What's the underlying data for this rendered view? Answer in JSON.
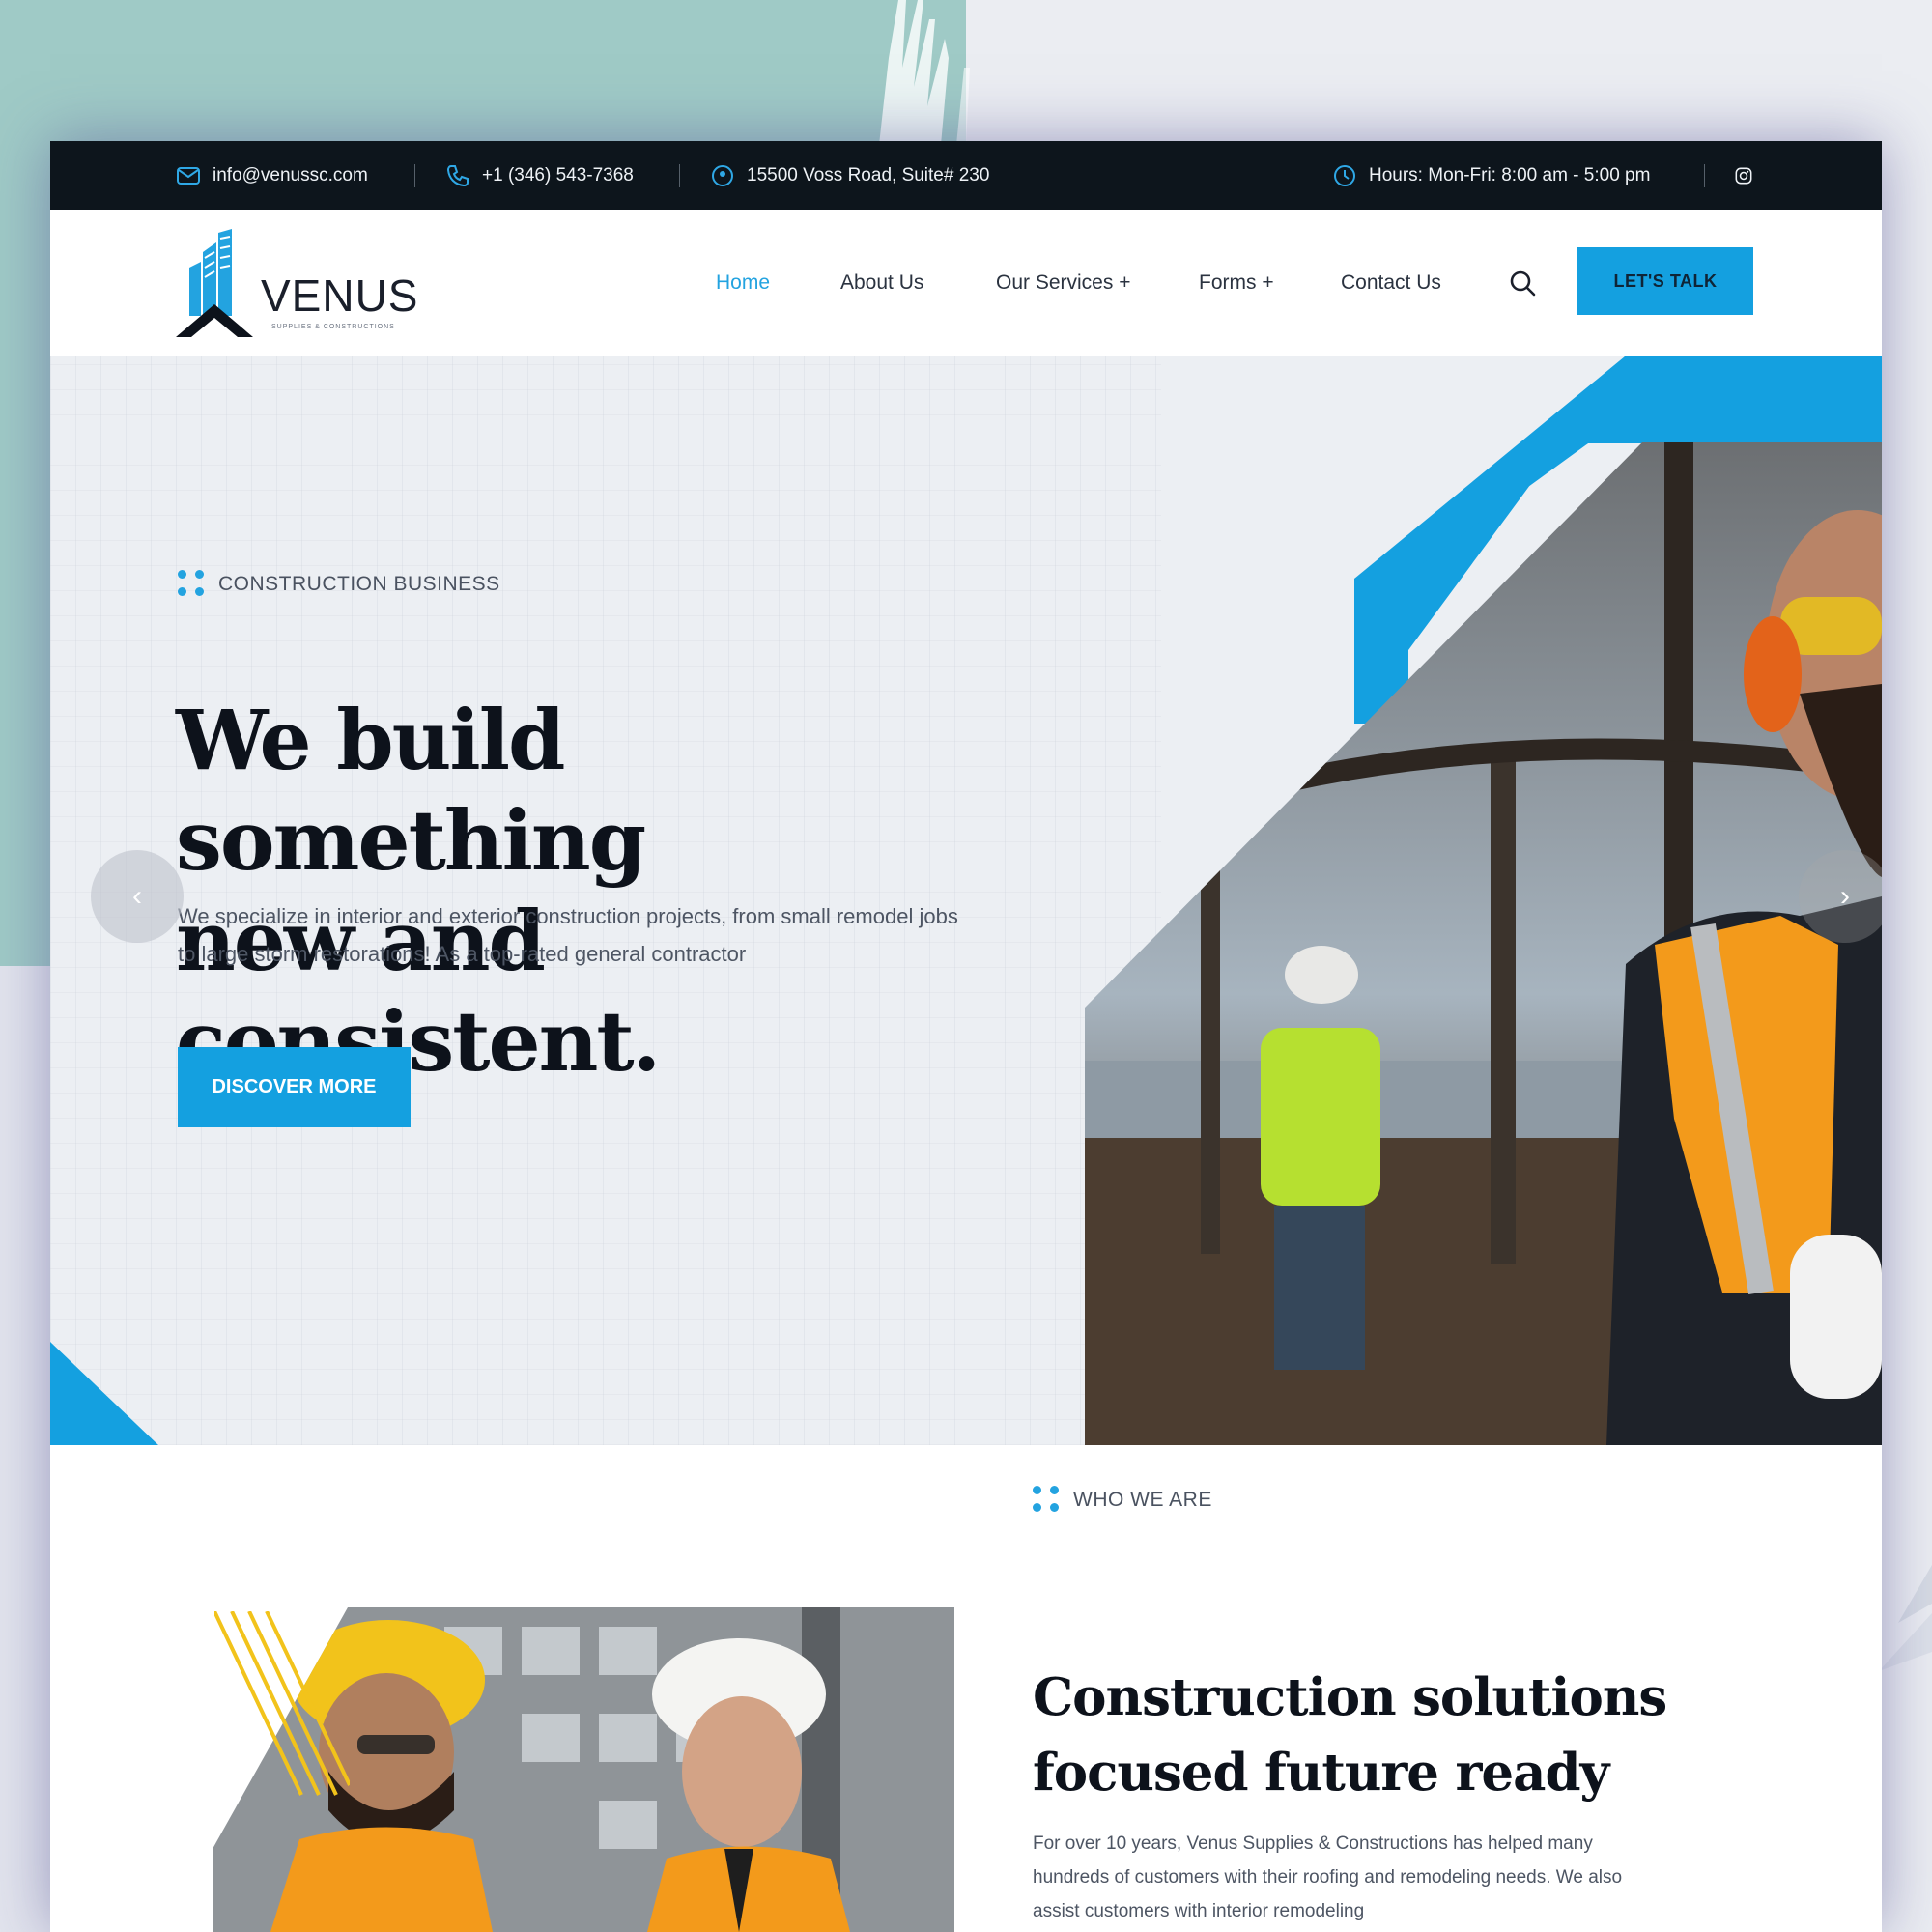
{
  "topbar": {
    "email": "info@venussc.com",
    "phone": "+1 (346) 543-7368",
    "address": "15500 Voss Road, Suite# 230",
    "hours": "Hours: Mon-Fri: 8:00 am - 5:00 pm",
    "icons": [
      "mail-icon",
      "phone-icon",
      "location-icon",
      "clock-icon",
      "instagram-icon"
    ]
  },
  "header": {
    "logo_text": "VENUS",
    "logo_tagline": "SUPPLIES & CONSTRUCTIONS",
    "nav": [
      "Home",
      "About Us",
      "Our Services +",
      "Forms +",
      "Contact Us"
    ],
    "active_nav": "Home",
    "cta": "LET'S TALK"
  },
  "hero": {
    "eyebrow": "CONSTRUCTION BUSINESS",
    "title_line1": "We build something",
    "title_line2": "new and consistent.",
    "description": "We specialize in interior and exterior construction projects, from small remodel jobs to large storm restorations! As a top-rated general contractor",
    "button": "DISCOVER MORE",
    "prev_arrow": "‹",
    "next_arrow": "›"
  },
  "about": {
    "eyebrow": "WHO WE ARE",
    "title_line1": "Construction solutions",
    "title_line2": "focused future ready",
    "description": "For over 10 years, Venus Supplies & Constructions has helped many hundreds of customers with their roofing and remodeling needs. We also assist customers with interior remodeling"
  },
  "colors": {
    "accent": "#14a0e0",
    "topbar_bg": "#0d151c",
    "heading": "#0d121b",
    "backdrop_teal": "#9fcac6"
  }
}
